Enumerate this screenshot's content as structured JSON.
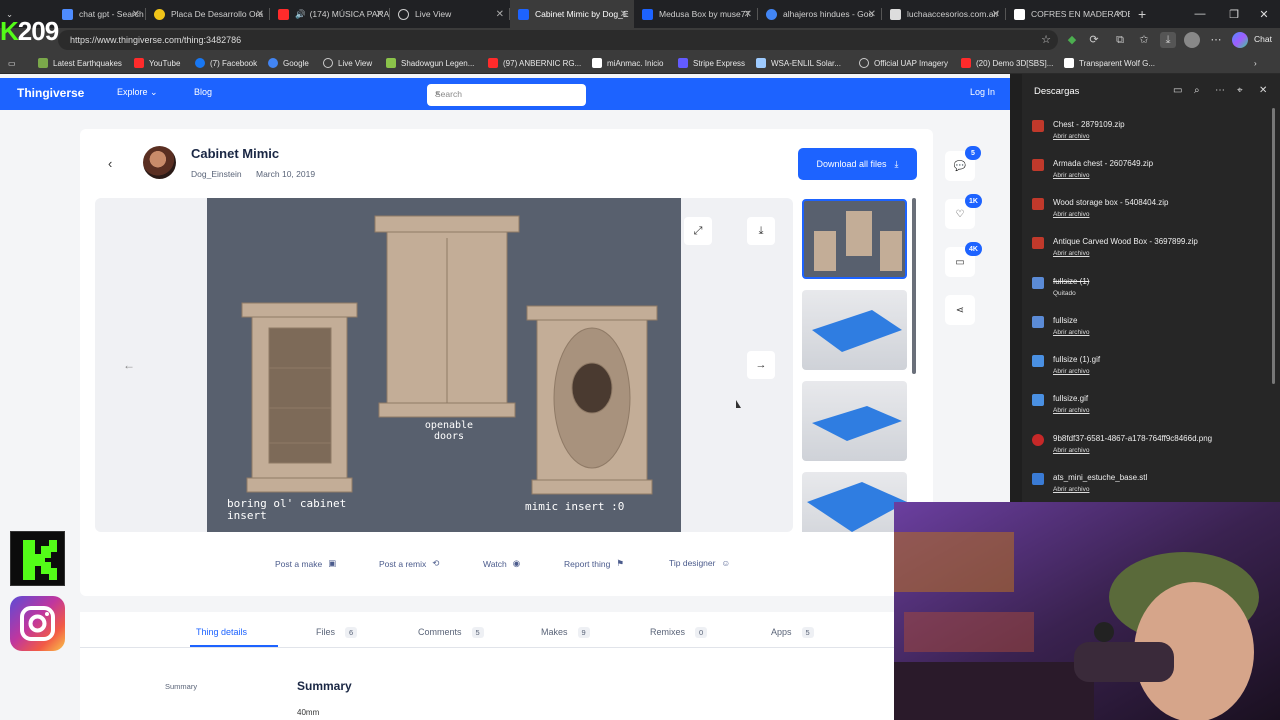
{
  "browser": {
    "tabs": [
      {
        "label": "chat gpt - Search",
        "color": "#4e8cff"
      },
      {
        "label": "Placa De Desarrollo Ora",
        "color": "#f0c419"
      },
      {
        "label": "(174) MÚSICA PARA",
        "color": "#ff2b2b"
      },
      {
        "label": "Live View",
        "color": "#cccccc"
      },
      {
        "label": "Cabinet Mimic by Dog_E",
        "color": "#1d63ff"
      },
      {
        "label": "Medusa Box by muse77",
        "color": "#1d63ff"
      },
      {
        "label": "alhajeros hindues - Goo",
        "color": "#4285f4"
      },
      {
        "label": "luchaaccesorios.com.ar/",
        "color": "#dddddd"
      },
      {
        "label": "COFRES EN MADERA DE",
        "color": "#ffffff"
      }
    ],
    "url": "https://www.thingiverse.com/thing:3482786",
    "chat_label": "Chat",
    "bookmarks": [
      {
        "label": "Latest Earthquakes",
        "color": "#7aa84a"
      },
      {
        "label": "YouTube",
        "color": "#ff2b2b"
      },
      {
        "label": "(7) Facebook",
        "color": "#1877f2"
      },
      {
        "label": "Google",
        "color": "#4285f4"
      },
      {
        "label": "Live View",
        "color": "#cccccc"
      },
      {
        "label": "Shadowgun Legen...",
        "color": "#8bc34a"
      },
      {
        "label": "(97) ANBERNIC RG...",
        "color": "#ff2b2b"
      },
      {
        "label": "miAnmac. Inicio",
        "color": "#ffffff"
      },
      {
        "label": "Stripe Express",
        "color": "#635bff"
      },
      {
        "label": "WSA-ENLIL Solar...",
        "color": "#9ecbff"
      },
      {
        "label": "Official UAP Imagery",
        "color": "#cccccc"
      },
      {
        "label": "(20) Demo 3D[SBS]...",
        "color": "#ff2b2b"
      },
      {
        "label": "Transparent Wolf G...",
        "color": "#ffffff"
      }
    ]
  },
  "overlay": {
    "counter": "209"
  },
  "site": {
    "logo": "Thingiverse",
    "explore": "Explore",
    "blog": "Blog",
    "search_placeholder": "Search",
    "login": "Log In"
  },
  "thing": {
    "title": "Cabinet Mimic",
    "author": "Dog_Einstein",
    "date": "March 10, 2019",
    "download_all": "Download all files",
    "image_captions": {
      "left": "boring ol' cabinet insert",
      "center": "openable doors",
      "right": "mimic insert :0"
    },
    "actions": [
      "Post a make",
      "Post a remix",
      "Watch",
      "Report thing",
      "Tip designer"
    ],
    "side_counts": {
      "comments": "5",
      "likes": "1K",
      "collections": "4K"
    },
    "tabs": [
      {
        "label": "Thing details",
        "count": ""
      },
      {
        "label": "Files",
        "count": "6"
      },
      {
        "label": "Comments",
        "count": "5"
      },
      {
        "label": "Makes",
        "count": "9"
      },
      {
        "label": "Remixes",
        "count": "0"
      },
      {
        "label": "Apps",
        "count": "5"
      }
    ],
    "summary_nav": "Summary",
    "summary_heading": "Summary",
    "summary_text": "40mm"
  },
  "downloads": {
    "title": "Descargas",
    "items": [
      {
        "name": "Chest - 2879109.zip",
        "action": "Abrir archivo",
        "removed": false,
        "color": "#c0392b"
      },
      {
        "name": "Armada chest - 2607649.zip",
        "action": "Abrir archivo",
        "removed": false,
        "color": "#c0392b"
      },
      {
        "name": "Wood storage box - 5408404.zip",
        "action": "Abrir archivo",
        "removed": false,
        "color": "#c0392b"
      },
      {
        "name": "Antique Carved Wood Box - 3697899.zip",
        "action": "Abrir archivo",
        "removed": false,
        "color": "#c0392b"
      },
      {
        "name": "fullsize (1)",
        "action": "Quitado",
        "removed": true,
        "color": "#5b8bd6"
      },
      {
        "name": "fullsize",
        "action": "Abrir archivo",
        "removed": false,
        "color": "#5b8bd6"
      },
      {
        "name": "fullsize (1).gif",
        "action": "Abrir archivo",
        "removed": false,
        "color": "#4a90e2"
      },
      {
        "name": "fullsize.gif",
        "action": "Abrir archivo",
        "removed": false,
        "color": "#4a90e2"
      },
      {
        "name": "9b8fdf37-6581-4867-a178-764ff9c8466d.png",
        "action": "Abrir archivo",
        "removed": false,
        "color": "#c62828"
      },
      {
        "name": "ats_mini_estuche_base.stl",
        "action": "Abrir archivo",
        "removed": false,
        "color": "#3a7bd5"
      }
    ]
  }
}
